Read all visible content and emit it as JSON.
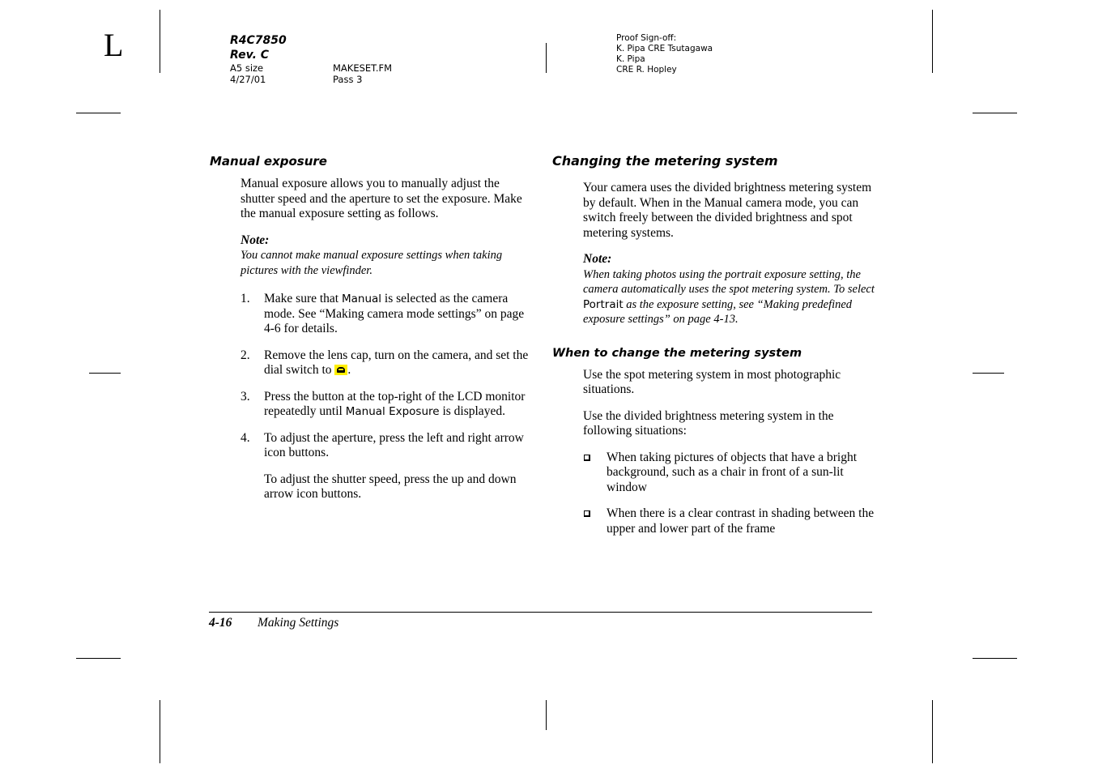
{
  "corner_mark": "L",
  "header": {
    "doc_code": "R4C7850",
    "revision": "Rev. C",
    "size": "A5 size",
    "date": "4/27/01",
    "file": "MAKESET.FM",
    "pass": "Pass 3",
    "proof_signoff": [
      "Proof Sign-off:",
      "K. Pipa CRE Tsutagawa",
      "K. Pipa",
      "CRE R. Hopley"
    ]
  },
  "left_column": {
    "heading": "Manual exposure",
    "intro": "Manual exposure allows you to manually adjust the shutter speed and the aperture to set the exposure. Make the manual exposure setting as follows.",
    "note_label": "Note:",
    "note_text": "You cannot make manual exposure settings when taking pictures with the viewfinder.",
    "steps": [
      {
        "num": "1.",
        "pre": "Make sure that ",
        "term": "Manual",
        "post": " is selected as the camera mode. See “Making camera mode settings” on page 4-6 for details."
      },
      {
        "num": "2.",
        "pre": "Remove the lens cap, turn on the camera, and set the dial switch to ",
        "icon": "camera-dial-icon",
        "post": "."
      },
      {
        "num": "3.",
        "pre": "Press the button at the top-right of the LCD monitor repeatedly until ",
        "term": "Manual Exposure",
        "post": " is displayed."
      },
      {
        "num": "4.",
        "text": "To adjust the aperture, press the left and right arrow icon buttons.",
        "extra": "To adjust the shutter speed, press the up and down arrow icon buttons."
      }
    ]
  },
  "right_column": {
    "heading": "Changing the metering system",
    "intro": "Your camera uses the divided brightness metering system by default. When in the Manual camera mode, you can switch freely between the divided brightness and spot metering systems.",
    "note_label": "Note:",
    "note_pre": "When taking photos using the portrait exposure setting, the camera automatically uses the spot metering system. To select ",
    "note_term": "Portrait",
    "note_post": " as the exposure setting, see “Making predefined exposure settings” on page 4-13.",
    "subheading": "When to change the metering system",
    "para1": "Use the spot metering system in most photographic situations.",
    "para2": "Use the divided brightness metering system in the following situations:",
    "bullets": [
      "When taking pictures of objects that have a bright background, such as a chair in front of a sun-lit window",
      "When there is a clear contrast in shading between the upper and lower part of the frame"
    ]
  },
  "footer": {
    "page_number": "4-16",
    "section": "Making Settings"
  },
  "colors": {
    "icon_highlight": "#ffef00"
  }
}
